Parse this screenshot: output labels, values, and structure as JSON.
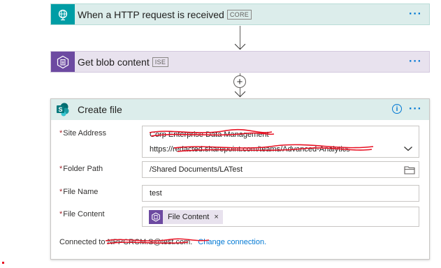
{
  "trigger": {
    "title": "When a HTTP request is received",
    "badge": "CORE",
    "more": "···"
  },
  "blob": {
    "title": "Get blob content",
    "badge": "ISE",
    "more": "···"
  },
  "add_step": {
    "label": "+"
  },
  "create_file": {
    "title": "Create file",
    "info": "i",
    "more": "···",
    "required_mark": "*",
    "site_address": {
      "label": "Site Address",
      "line1": "Corp Enterprise Data Management",
      "line2": "https://redacted.sharepoint.com/teams/Advanced-Analytics"
    },
    "folder_path": {
      "label": "Folder Path",
      "value": "/Shared Documents/LATest"
    },
    "file_name": {
      "label": "File Name",
      "value": "test"
    },
    "file_content": {
      "label": "File Content",
      "token": "File Content",
      "token_remove": "×"
    },
    "connection": {
      "prefix": "Connected to",
      "account": "NPPCRCM.S@test.com.",
      "change_link": "Change connection."
    }
  },
  "colors": {
    "trigger_accent": "#009da5",
    "blob_accent": "#6d4aa1",
    "link": "#0078d4",
    "required": "#a4262c",
    "redaction": "#e81123"
  },
  "icons": [
    "http-request-icon",
    "blob-storage-icon",
    "sharepoint-icon",
    "info-icon",
    "folder-icon",
    "chevron-down-icon"
  ]
}
